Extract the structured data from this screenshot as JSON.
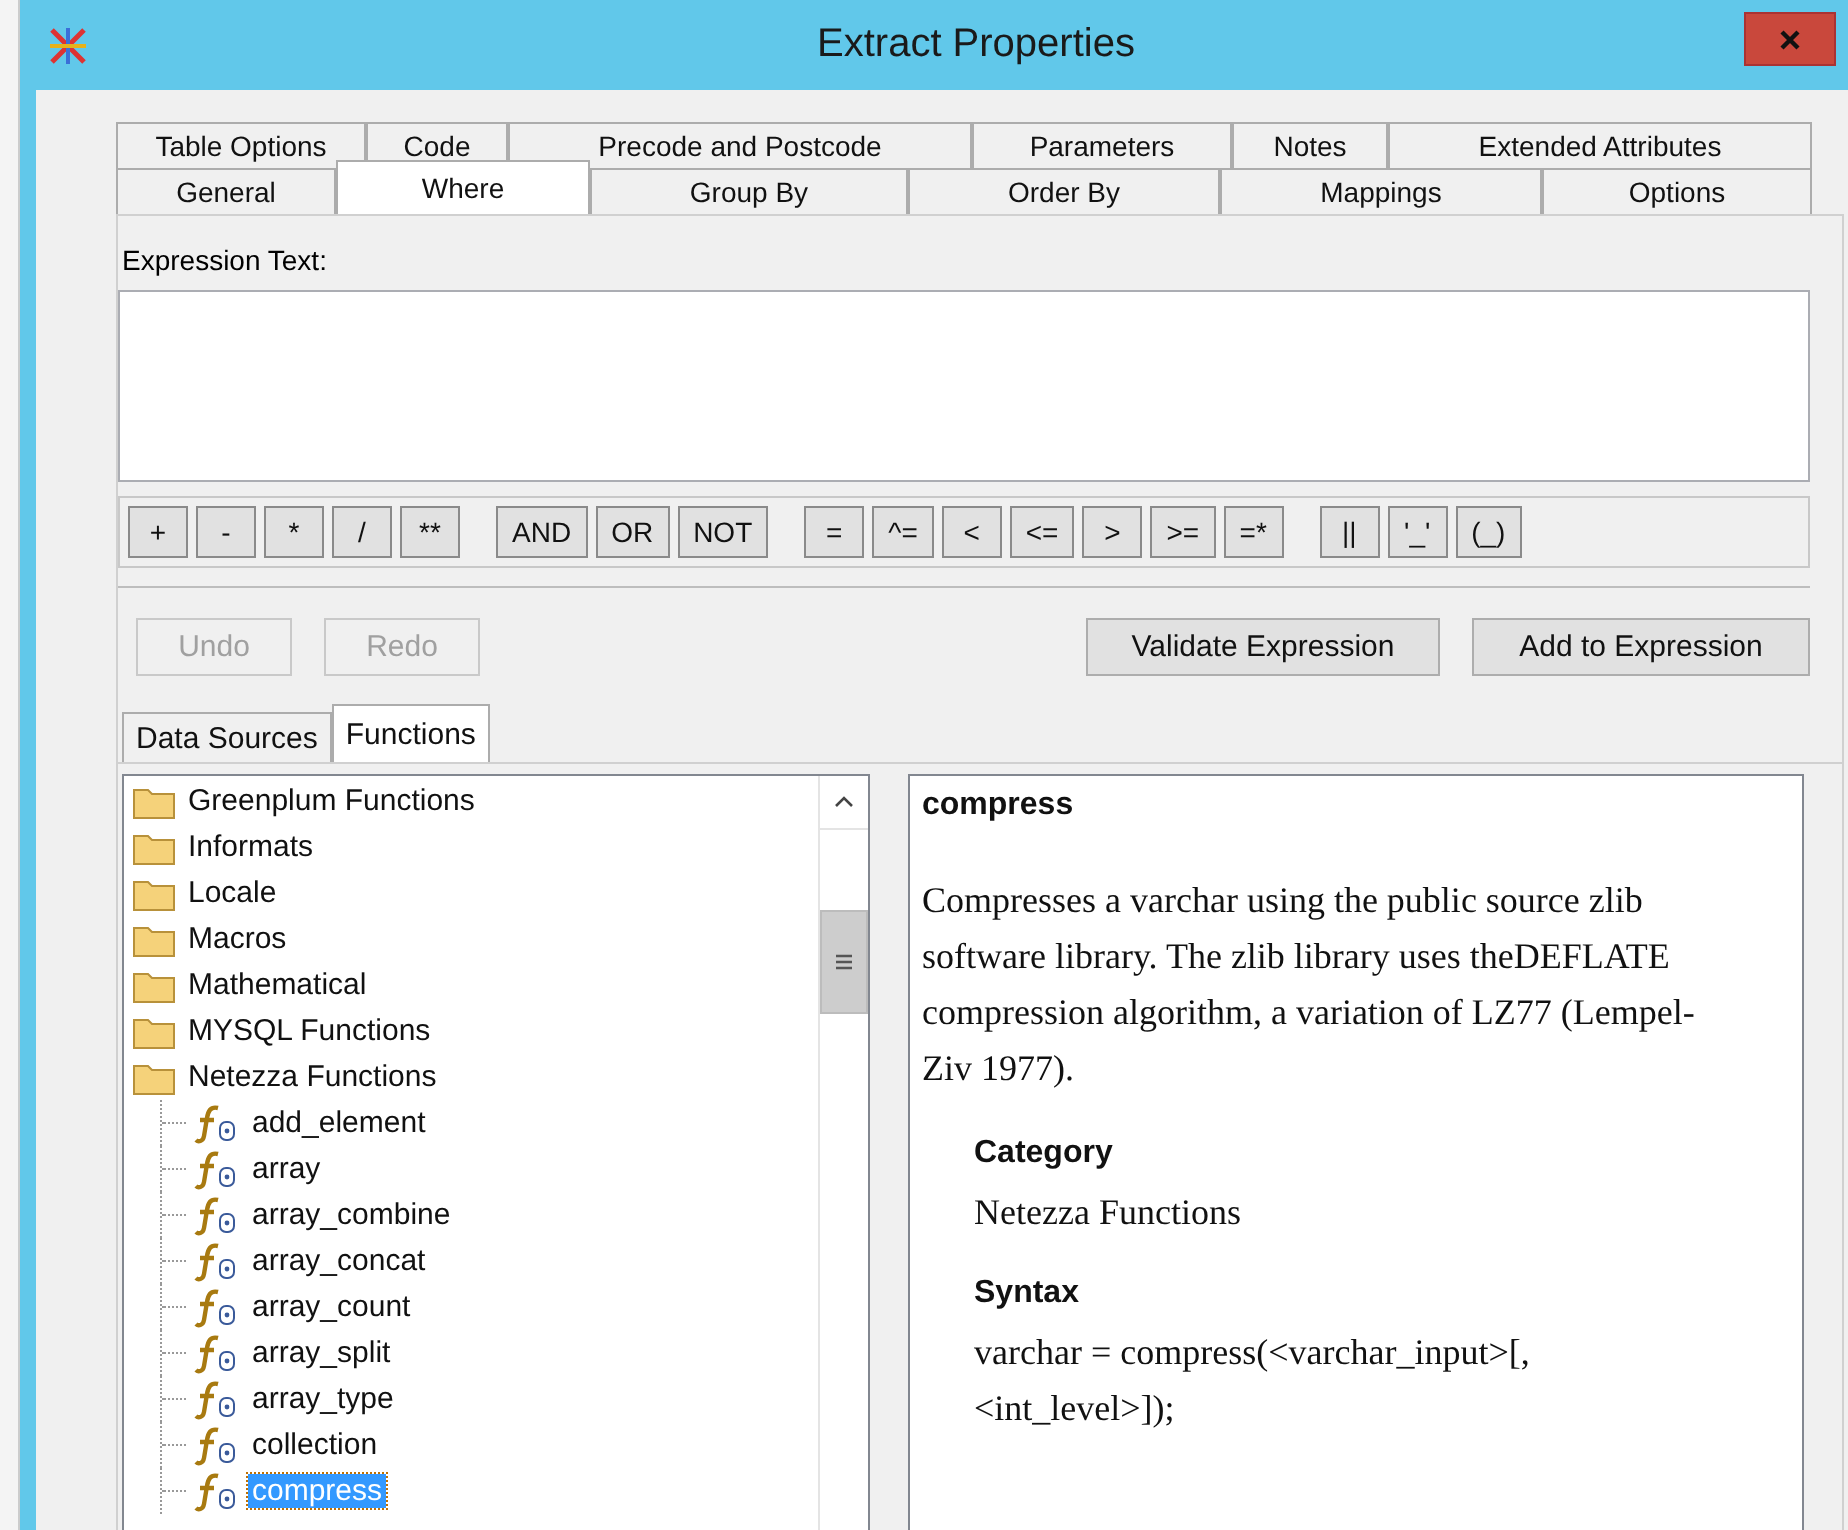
{
  "window": {
    "title": "Extract Properties"
  },
  "tab_rows": [
    [
      {
        "label": "Table Options",
        "selected": false
      },
      {
        "label": "Code",
        "selected": false
      },
      {
        "label": "Precode and Postcode",
        "selected": false
      },
      {
        "label": "Parameters",
        "selected": false
      },
      {
        "label": "Notes",
        "selected": false
      },
      {
        "label": "Extended Attributes",
        "selected": false
      }
    ],
    [
      {
        "label": "General",
        "selected": false
      },
      {
        "label": "Where",
        "selected": true
      },
      {
        "label": "Group By",
        "selected": false
      },
      {
        "label": "Order By",
        "selected": false
      },
      {
        "label": "Mappings",
        "selected": false
      },
      {
        "label": "Options",
        "selected": false
      }
    ]
  ],
  "expression": {
    "label": "Expression Text:"
  },
  "operator_groups": [
    [
      "+",
      "-",
      "*",
      "/",
      "**"
    ],
    [
      "AND",
      "OR",
      "NOT"
    ],
    [
      "=",
      "^=",
      "<",
      "<=",
      ">",
      ">=",
      "=*"
    ],
    [
      "||",
      "'_'",
      "(_)"
    ]
  ],
  "actions": [
    {
      "label": "Undo",
      "disabled": true
    },
    {
      "label": "Redo",
      "disabled": true
    },
    {
      "label": "Validate Expression",
      "disabled": false
    },
    {
      "label": "Add to Expression",
      "disabled": false
    }
  ],
  "sub_tabs": [
    {
      "label": "Data Sources",
      "selected": false
    },
    {
      "label": "Functions",
      "selected": true
    }
  ],
  "tree": [
    {
      "kind": "folder",
      "label": "Greenplum Functions",
      "selected": false
    },
    {
      "kind": "folder",
      "label": "Informats",
      "selected": false
    },
    {
      "kind": "folder",
      "label": "Locale",
      "selected": false
    },
    {
      "kind": "folder",
      "label": "Macros",
      "selected": false
    },
    {
      "kind": "folder",
      "label": "Mathematical",
      "selected": false
    },
    {
      "kind": "folder",
      "label": "MYSQL Functions",
      "selected": false
    },
    {
      "kind": "folder",
      "label": "Netezza Functions",
      "selected": false,
      "children": [
        {
          "kind": "function",
          "label": "add_element",
          "selected": false
        },
        {
          "kind": "function",
          "label": "array",
          "selected": false
        },
        {
          "kind": "function",
          "label": "array_combine",
          "selected": false
        },
        {
          "kind": "function",
          "label": "array_concat",
          "selected": false
        },
        {
          "kind": "function",
          "label": "array_count",
          "selected": false
        },
        {
          "kind": "function",
          "label": "array_split",
          "selected": false
        },
        {
          "kind": "function",
          "label": "array_type",
          "selected": false
        },
        {
          "kind": "function",
          "label": "collection",
          "selected": false
        },
        {
          "kind": "function",
          "label": "compress",
          "selected": true
        }
      ]
    }
  ],
  "help": {
    "title": "compress",
    "description": "Compresses a varchar using the public source zlib software library. The zlib library uses theDEFLATE compression algorithm, a variation of LZ77 (Lempel-Ziv 1977).",
    "sections": [
      {
        "heading": "Category",
        "text": "Netezza Functions"
      },
      {
        "heading": "Syntax",
        "text": "varchar = compress(<varchar_input>[, <int_level>]);"
      }
    ]
  }
}
